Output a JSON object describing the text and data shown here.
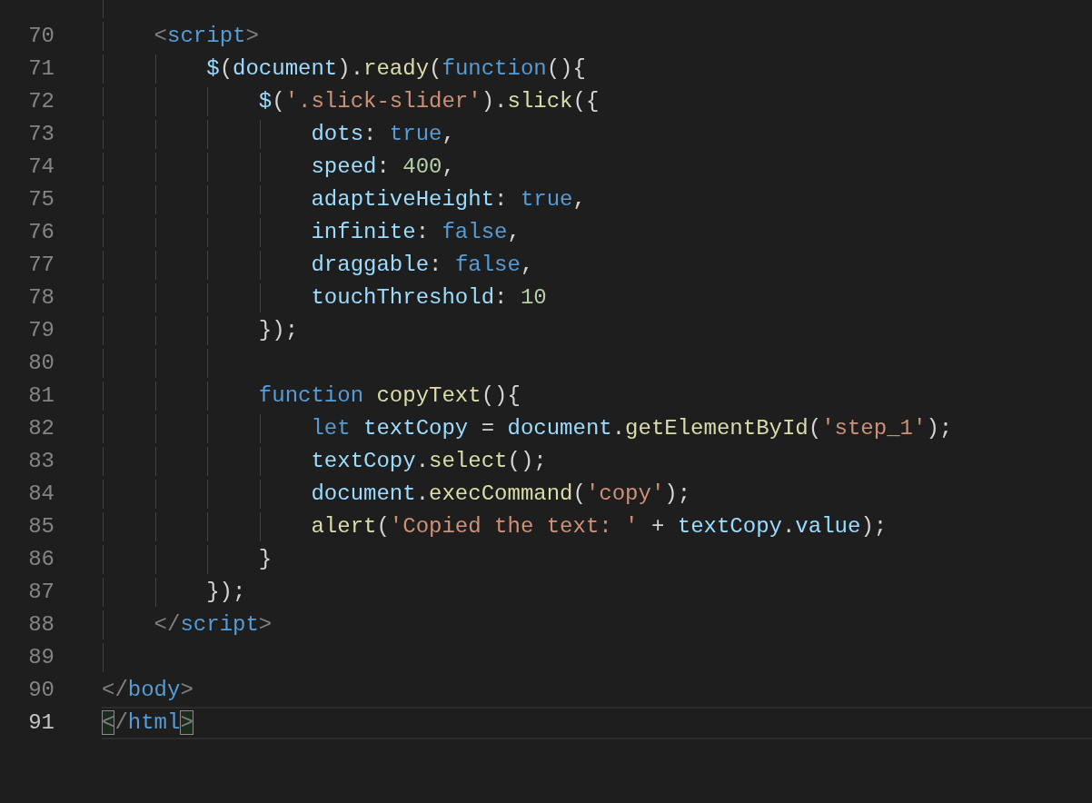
{
  "editor": {
    "lines": [
      {
        "number": "70",
        "current": false,
        "tokens": [
          {
            "kind": "bracket",
            "text": "    <"
          },
          {
            "kind": "tag",
            "text": "script"
          },
          {
            "kind": "bracket",
            "text": ">"
          }
        ]
      },
      {
        "number": "71",
        "current": false,
        "tokens": [
          {
            "kind": "variable",
            "text": "        $"
          },
          {
            "kind": "punct",
            "text": "("
          },
          {
            "kind": "variable",
            "text": "document"
          },
          {
            "kind": "punct",
            "text": ")."
          },
          {
            "kind": "function",
            "text": "ready"
          },
          {
            "kind": "punct",
            "text": "("
          },
          {
            "kind": "keyword",
            "text": "function"
          },
          {
            "kind": "punct",
            "text": "(){"
          }
        ]
      },
      {
        "number": "72",
        "current": false,
        "tokens": [
          {
            "kind": "variable",
            "text": "            $"
          },
          {
            "kind": "punct",
            "text": "("
          },
          {
            "kind": "string",
            "text": "'.slick-slider'"
          },
          {
            "kind": "punct",
            "text": ")."
          },
          {
            "kind": "function",
            "text": "slick"
          },
          {
            "kind": "punct",
            "text": "({"
          }
        ]
      },
      {
        "number": "73",
        "current": false,
        "tokens": [
          {
            "kind": "variable",
            "text": "                dots"
          },
          {
            "kind": "punct",
            "text": ": "
          },
          {
            "kind": "keyword",
            "text": "true"
          },
          {
            "kind": "punct",
            "text": ","
          }
        ]
      },
      {
        "number": "74",
        "current": false,
        "tokens": [
          {
            "kind": "variable",
            "text": "                speed"
          },
          {
            "kind": "punct",
            "text": ": "
          },
          {
            "kind": "number",
            "text": "400"
          },
          {
            "kind": "punct",
            "text": ","
          }
        ]
      },
      {
        "number": "75",
        "current": false,
        "tokens": [
          {
            "kind": "variable",
            "text": "                adaptiveHeight"
          },
          {
            "kind": "punct",
            "text": ": "
          },
          {
            "kind": "keyword",
            "text": "true"
          },
          {
            "kind": "punct",
            "text": ","
          }
        ]
      },
      {
        "number": "76",
        "current": false,
        "tokens": [
          {
            "kind": "variable",
            "text": "                infinite"
          },
          {
            "kind": "punct",
            "text": ": "
          },
          {
            "kind": "keyword",
            "text": "false"
          },
          {
            "kind": "punct",
            "text": ","
          }
        ]
      },
      {
        "number": "77",
        "current": false,
        "tokens": [
          {
            "kind": "variable",
            "text": "                draggable"
          },
          {
            "kind": "punct",
            "text": ": "
          },
          {
            "kind": "keyword",
            "text": "false"
          },
          {
            "kind": "punct",
            "text": ","
          }
        ]
      },
      {
        "number": "78",
        "current": false,
        "tokens": [
          {
            "kind": "variable",
            "text": "                touchThreshold"
          },
          {
            "kind": "punct",
            "text": ": "
          },
          {
            "kind": "number",
            "text": "10"
          }
        ]
      },
      {
        "number": "79",
        "current": false,
        "tokens": [
          {
            "kind": "punct",
            "text": "            });"
          }
        ]
      },
      {
        "number": "80",
        "current": false
      },
      {
        "number": "81",
        "current": false,
        "tokens": [
          {
            "kind": "keyword",
            "text": "            function "
          },
          {
            "kind": "function",
            "text": "copyText"
          },
          {
            "kind": "punct",
            "text": "(){"
          }
        ]
      },
      {
        "number": "82",
        "current": false,
        "tokens": [
          {
            "kind": "keyword",
            "text": "                let "
          },
          {
            "kind": "variable",
            "text": "textCopy"
          },
          {
            "kind": "punct",
            "text": " = "
          },
          {
            "kind": "variable",
            "text": "document"
          },
          {
            "kind": "punct",
            "text": "."
          },
          {
            "kind": "function",
            "text": "getElementById"
          },
          {
            "kind": "punct",
            "text": "("
          },
          {
            "kind": "string",
            "text": "'step_1'"
          },
          {
            "kind": "punct",
            "text": ");"
          }
        ]
      },
      {
        "number": "83",
        "current": false,
        "tokens": [
          {
            "kind": "variable",
            "text": "                textCopy"
          },
          {
            "kind": "punct",
            "text": "."
          },
          {
            "kind": "function",
            "text": "select"
          },
          {
            "kind": "punct",
            "text": "();"
          }
        ]
      },
      {
        "number": "84",
        "current": false,
        "tokens": [
          {
            "kind": "variable",
            "text": "                document"
          },
          {
            "kind": "punct",
            "text": "."
          },
          {
            "kind": "function",
            "text": "execCommand"
          },
          {
            "kind": "punct",
            "text": "("
          },
          {
            "kind": "string",
            "text": "'copy'"
          },
          {
            "kind": "punct",
            "text": ");"
          }
        ]
      },
      {
        "number": "85",
        "current": false,
        "tokens": [
          {
            "kind": "function",
            "text": "                alert"
          },
          {
            "kind": "punct",
            "text": "("
          },
          {
            "kind": "string",
            "text": "'Copied the text: '"
          },
          {
            "kind": "punct",
            "text": " + "
          },
          {
            "kind": "variable",
            "text": "textCopy"
          },
          {
            "kind": "punct",
            "text": "."
          },
          {
            "kind": "variable",
            "text": "value"
          },
          {
            "kind": "punct",
            "text": ");"
          }
        ]
      },
      {
        "number": "86",
        "current": false,
        "tokens": [
          {
            "kind": "punct",
            "text": "            }"
          }
        ]
      },
      {
        "number": "87",
        "current": false,
        "tokens": [
          {
            "kind": "punct",
            "text": "        });"
          }
        ]
      },
      {
        "number": "88",
        "current": false,
        "tokens": [
          {
            "kind": "bracket",
            "text": "    </"
          },
          {
            "kind": "tag",
            "text": "script"
          },
          {
            "kind": "bracket",
            "text": ">"
          }
        ]
      },
      {
        "number": "89",
        "current": false
      },
      {
        "number": "90",
        "current": false,
        "tokens": [
          {
            "kind": "bracket",
            "text": "</"
          },
          {
            "kind": "tag",
            "text": "body"
          },
          {
            "kind": "bracket",
            "text": ">"
          }
        ]
      },
      {
        "number": "91",
        "current": true,
        "tokens": [
          {
            "kind": "match",
            "text": "<"
          },
          {
            "kind": "bracket",
            "text": "/"
          },
          {
            "kind": "tag",
            "text": "html"
          },
          {
            "kind": "match",
            "text": ">"
          }
        ]
      }
    ]
  }
}
